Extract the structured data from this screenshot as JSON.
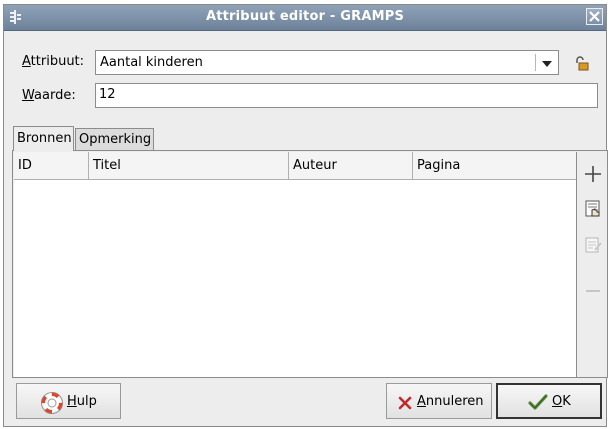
{
  "window": {
    "title": "Attribuut editor - GRAMPS"
  },
  "form": {
    "attribute": {
      "label_prefix": "",
      "label_underline": "A",
      "label_rest": "ttribuut:",
      "value": "Aantal kinderen"
    },
    "value_field": {
      "label_underline": "W",
      "label_rest": "aarde:",
      "value": "12"
    }
  },
  "tabs": [
    {
      "label": "Bronnen"
    },
    {
      "label": "Opmerking"
    }
  ],
  "table": {
    "columns": [
      "ID",
      "Titel",
      "Auteur",
      "Pagina"
    ]
  },
  "buttons": {
    "help": {
      "underline": "H",
      "rest": "ulp"
    },
    "cancel": {
      "underline": "A",
      "rest": "nnuleren"
    },
    "ok": {
      "underline": "O",
      "rest": "K"
    }
  },
  "colors": {
    "titlebar": "#7d90a6",
    "window_bg": "#ededed",
    "cancel_x": "#c0282e",
    "help_ring": "#e0452b",
    "ok_check": "#5a8a3a"
  }
}
